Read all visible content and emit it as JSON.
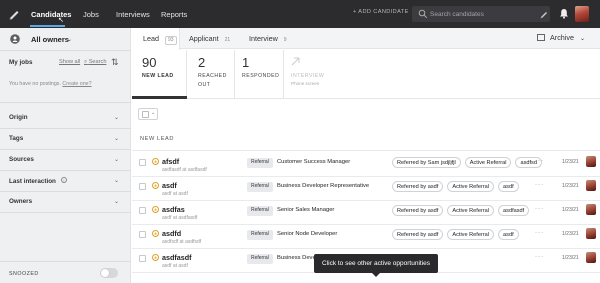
{
  "nav": {
    "links": [
      "Candidates",
      "Jobs",
      "Interviews",
      "Reports"
    ],
    "add_candidate": "+ ADD CANDIDATE",
    "search_placeholder": "Search candidates"
  },
  "sidebar": {
    "owners": "All owners",
    "my_jobs": "My jobs",
    "show_all": "Show all",
    "search": "Search",
    "no_postings": "You have no postings.",
    "create_one": "Create one?",
    "filters": [
      "Origin",
      "Tags",
      "Sources",
      "Last interaction",
      "Owners"
    ],
    "snoozed": "SNOOZED"
  },
  "tabs": [
    {
      "label": "Lead",
      "count": "93"
    },
    {
      "label": "Applicant",
      "count": "21"
    },
    {
      "label": "Interview",
      "count": "9"
    }
  ],
  "archive": "Archive",
  "stages": [
    {
      "num": "90",
      "label": "NEW LEAD"
    },
    {
      "num": "2",
      "label": "REACHED OUT"
    },
    {
      "num": "1",
      "label": "RESPONDED"
    },
    {
      "label": "INTERVIEW",
      "sub": "Phone screen"
    }
  ],
  "list_header": "NEW LEAD",
  "rows": [
    {
      "name": "afsdf",
      "sub": "asdfasdf at asdfasdf",
      "source": "Referral",
      "position": "Customer Success Manager",
      "tags": [
        "Referred by Sam jsdjljfjl",
        "Active Referral",
        "asdfsd"
      ],
      "date": "1/23/21"
    },
    {
      "name": "asdf",
      "sub": "asdf at asdf",
      "source": "Referral",
      "position": "Business Developer Representative",
      "tags": [
        "Referred by asdf",
        "Active Referral",
        "asdf"
      ],
      "date": "1/23/21"
    },
    {
      "name": "asdfas",
      "sub": "asdf at asdfasdf",
      "source": "Referral",
      "position": "Senior Sales Manager",
      "tags": [
        "Referred by asdf",
        "Active Referral",
        "asdfasdf"
      ],
      "date": "1/23/21"
    },
    {
      "name": "asdfd",
      "sub": "asdfsdf at asdfsdf",
      "source": "Referral",
      "position": "Senior Node Developer",
      "tags": [
        "Referred by asdf",
        "Active Referral",
        "asdf"
      ],
      "date": "1/23/21"
    },
    {
      "name": "asdfasdf",
      "sub": "asdf at asdf",
      "source": "Referral",
      "position": "Business Deve",
      "tags": [],
      "date": "1/23/21"
    }
  ],
  "tooltip": "Click to see other active opportunities",
  "colors": {
    "nav_bg": "#2c2c2e",
    "accent": "#5aa9e6",
    "star": "#e0a020"
  }
}
